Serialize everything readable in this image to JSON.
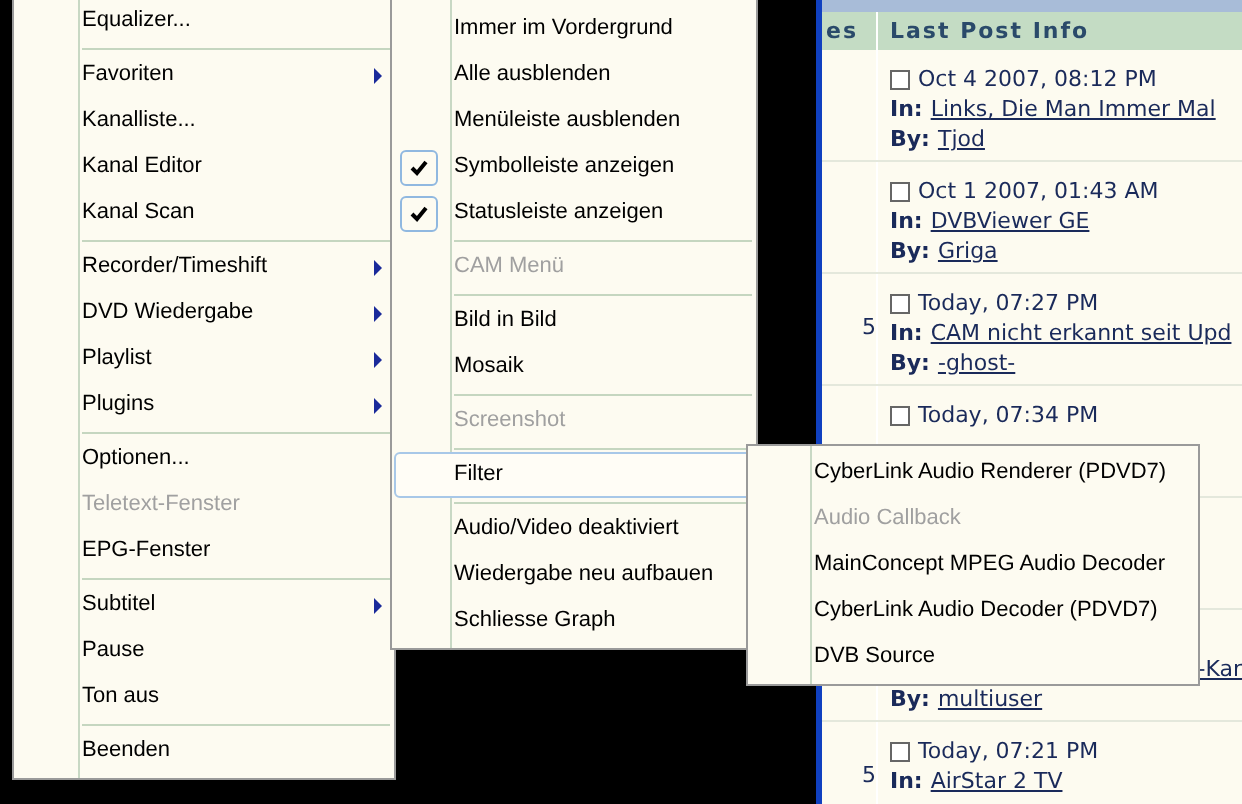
{
  "forum": {
    "header": {
      "column_1": "es",
      "column_2": "Last Post Info"
    },
    "rows": [
      {
        "date": "Oct 4 2007, 08:12 PM",
        "in_label": "In:",
        "topic": "Links, Die Man Immer Mal",
        "by_label": "By:",
        "author": "Tjod"
      },
      {
        "date": "Oct 1 2007, 01:43 AM",
        "in_label": "In:",
        "topic": "DVBViewer GE",
        "by_label": "By:",
        "author": "Griga"
      },
      {
        "count": "5",
        "date": "Today, 07:27 PM",
        "in_label": "In:",
        "topic": "CAM nicht erkannt seit Upd",
        "by_label": "By:",
        "author": "-ghost-"
      },
      {
        "date": "Today, 07:34 PM"
      },
      {},
      {
        "topic": "-Kar",
        "by_label": "By:",
        "author": "multiuser"
      },
      {
        "count": "5",
        "date": "Today, 07:21 PM",
        "in_label": "In:",
        "topic": "AirStar 2 TV"
      }
    ]
  },
  "menus": [
    {
      "items": [
        {
          "kind": "item",
          "label": "Equalizer...",
          "submenu": false,
          "disabled": false
        },
        {
          "kind": "separator"
        },
        {
          "kind": "item",
          "label": "Favoriten",
          "submenu": true,
          "disabled": false
        },
        {
          "kind": "item",
          "label": "Kanalliste...",
          "submenu": false,
          "disabled": false
        },
        {
          "kind": "item",
          "label": "Kanal Editor",
          "submenu": false,
          "disabled": false
        },
        {
          "kind": "item",
          "label": "Kanal Scan",
          "submenu": false,
          "disabled": false
        },
        {
          "kind": "separator"
        },
        {
          "kind": "item",
          "label": "Recorder/Timeshift",
          "submenu": true,
          "disabled": false
        },
        {
          "kind": "item",
          "label": "DVD Wiedergabe",
          "submenu": true,
          "disabled": false
        },
        {
          "kind": "item",
          "label": "Playlist",
          "submenu": true,
          "disabled": false
        },
        {
          "kind": "item",
          "label": "Plugins",
          "submenu": true,
          "disabled": false
        },
        {
          "kind": "separator"
        },
        {
          "kind": "item",
          "label": "Optionen...",
          "submenu": false,
          "disabled": false
        },
        {
          "kind": "item",
          "label": "Teletext-Fenster",
          "submenu": false,
          "disabled": true
        },
        {
          "kind": "item",
          "label": "EPG-Fenster",
          "submenu": false,
          "disabled": false
        },
        {
          "kind": "separator"
        },
        {
          "kind": "item",
          "label": "Subtitel",
          "submenu": true,
          "disabled": false
        },
        {
          "kind": "item",
          "label": "Pause",
          "submenu": false,
          "disabled": false
        },
        {
          "kind": "item",
          "label": "Ton aus",
          "submenu": false,
          "disabled": false
        },
        {
          "kind": "separator"
        },
        {
          "kind": "item",
          "label": "Beenden",
          "submenu": false,
          "disabled": false
        }
      ]
    },
    {
      "items": [
        {
          "kind": "item",
          "label": "Immer im Vordergrund",
          "checked": false,
          "disabled": false,
          "selected": false
        },
        {
          "kind": "item",
          "label": "Alle ausblenden",
          "checked": false,
          "disabled": false,
          "selected": false
        },
        {
          "kind": "item",
          "label": "Menüleiste ausblenden",
          "checked": false,
          "disabled": false,
          "selected": false
        },
        {
          "kind": "item",
          "label": "Symbolleiste anzeigen",
          "checked": true,
          "disabled": false,
          "selected": false
        },
        {
          "kind": "item",
          "label": "Statusleiste anzeigen",
          "checked": true,
          "disabled": false,
          "selected": false
        },
        {
          "kind": "separator"
        },
        {
          "kind": "item",
          "label": "CAM Menü",
          "checked": false,
          "disabled": true,
          "selected": false
        },
        {
          "kind": "separator"
        },
        {
          "kind": "item",
          "label": "Bild in Bild",
          "checked": false,
          "disabled": false,
          "selected": false
        },
        {
          "kind": "item",
          "label": "Mosaik",
          "checked": false,
          "disabled": false,
          "selected": false
        },
        {
          "kind": "separator"
        },
        {
          "kind": "item",
          "label": "Screenshot",
          "checked": false,
          "disabled": true,
          "selected": false
        },
        {
          "kind": "separator"
        },
        {
          "kind": "item",
          "label": "Filter",
          "checked": false,
          "disabled": false,
          "selected": true
        },
        {
          "kind": "separator"
        },
        {
          "kind": "item",
          "label": "Audio/Video deaktiviert",
          "checked": false,
          "disabled": false,
          "selected": false
        },
        {
          "kind": "item",
          "label": "Wiedergabe neu aufbauen",
          "checked": false,
          "disabled": false,
          "selected": false
        },
        {
          "kind": "item",
          "label": "Schliesse Graph",
          "checked": false,
          "disabled": false,
          "selected": false
        }
      ]
    },
    {
      "items": [
        {
          "kind": "item",
          "label": "CyberLink Audio Renderer (PDVD7)",
          "disabled": false
        },
        {
          "kind": "item",
          "label": "Audio Callback",
          "disabled": true
        },
        {
          "kind": "item",
          "label": "MainConcept MPEG Audio Decoder",
          "disabled": false
        },
        {
          "kind": "item",
          "label": "CyberLink Audio Decoder (PDVD7)",
          "disabled": false
        },
        {
          "kind": "item",
          "label": "DVB Source",
          "disabled": false
        }
      ]
    }
  ]
}
